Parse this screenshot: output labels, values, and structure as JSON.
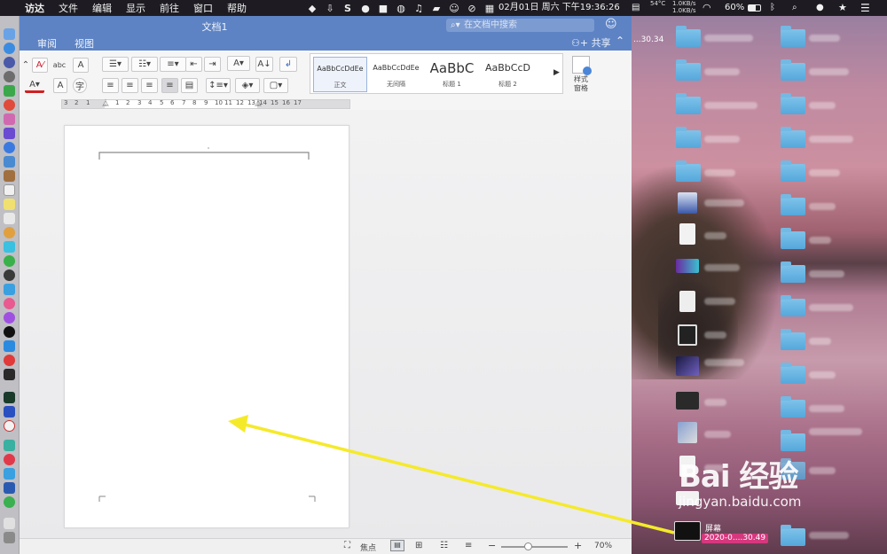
{
  "menubar": {
    "app_name": "访达",
    "items": [
      "文件",
      "编辑",
      "显示",
      "前往",
      "窗口",
      "帮助"
    ],
    "clock": "02月01日 周六 下午19:36:26",
    "temperature": "54°C",
    "net_up": "1.0KB/s",
    "net_down": "1.0KB/s",
    "battery": "60%"
  },
  "window": {
    "doc_title": "文档1",
    "search_placeholder": "在文档中搜索",
    "tabs": [
      "审阅",
      "视图"
    ],
    "share_label": "共享",
    "styles": [
      {
        "preview": "AaBbCcDdEe",
        "name": "正文"
      },
      {
        "preview": "AaBbCcDdEe",
        "name": "无间隔"
      },
      {
        "preview": "AaBbC",
        "name": "标题 1"
      },
      {
        "preview": "AaBbCcD",
        "name": "标题 2"
      }
    ],
    "styles_pane_label": "样式\n窗格",
    "ruler_numbers": [
      "3",
      "2",
      "1",
      "1",
      "2",
      "3",
      "4",
      "5",
      "6",
      "7",
      "8",
      "9",
      "10",
      "11",
      "12",
      "13",
      "14",
      "15",
      "16",
      "17"
    ],
    "status": {
      "focus_label": "焦点",
      "zoom": "70%"
    }
  },
  "desktop": {
    "partial_label": "...30.34",
    "screenshot_label": "2020-0....30.49",
    "screenshot_name": "屏幕"
  },
  "watermark": {
    "logo": "Bai 经验",
    "url": "jingyan.baidu.com"
  },
  "colors": {
    "title_bar": "#5d83c4",
    "arrow": "#f5ea2a",
    "menubar": "#1e1c22"
  }
}
